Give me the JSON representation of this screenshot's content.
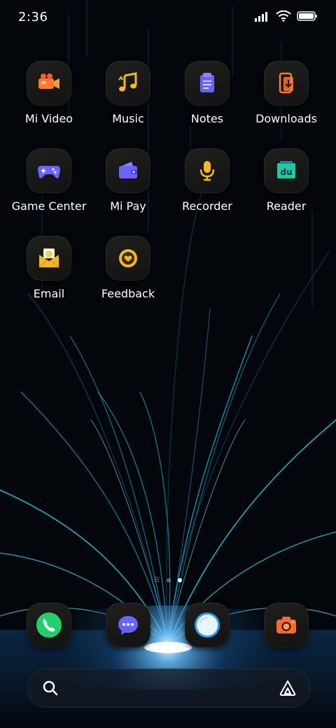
{
  "status_bar": {
    "time": "2:36",
    "icons": [
      "signal-icon",
      "wifi-icon",
      "battery-icon"
    ]
  },
  "apps": [
    {
      "id": "mi-video",
      "label": "Mi Video",
      "icon": "video-camera-icon",
      "color": "#ff7a2a"
    },
    {
      "id": "music",
      "label": "Music",
      "icon": "music-note-icon",
      "color": "#f5b822"
    },
    {
      "id": "notes",
      "label": "Notes",
      "icon": "notepad-icon",
      "color": "#6b63ff"
    },
    {
      "id": "downloads",
      "label": "Downloads",
      "icon": "download-phone-icon",
      "color": "#ff7a2a"
    },
    {
      "id": "game-center",
      "label": "Game Center",
      "icon": "gamepad-icon",
      "color": "#6b63ff"
    },
    {
      "id": "mi-pay",
      "label": "Mi Pay",
      "icon": "wallet-icon",
      "color": "#6b63ff"
    },
    {
      "id": "recorder",
      "label": "Recorder",
      "icon": "microphone-icon",
      "color": "#f5b822"
    },
    {
      "id": "reader",
      "label": "Reader",
      "icon": "reader-du-icon",
      "color": "#1fc9a8"
    },
    {
      "id": "email",
      "label": "Email",
      "icon": "envelope-icon",
      "color": "#f5b822"
    },
    {
      "id": "feedback",
      "label": "Feedback",
      "icon": "feedback-heart-icon",
      "color": "#f5b822"
    }
  ],
  "page_indicator": {
    "pages": 2,
    "current": 2
  },
  "dock": [
    {
      "id": "phone",
      "icon": "phone-icon",
      "color": "#1fd16b"
    },
    {
      "id": "messages",
      "icon": "chat-bubble-icon",
      "color": "#6b63ff"
    },
    {
      "id": "browser",
      "icon": "browser-circle-icon",
      "color": "#2e9cf5"
    },
    {
      "id": "camera",
      "icon": "camera-icon",
      "color": "#ff6a2a"
    }
  ],
  "search_bar": {
    "left_icon": "search-icon",
    "right_icon": "assistant-icon"
  }
}
